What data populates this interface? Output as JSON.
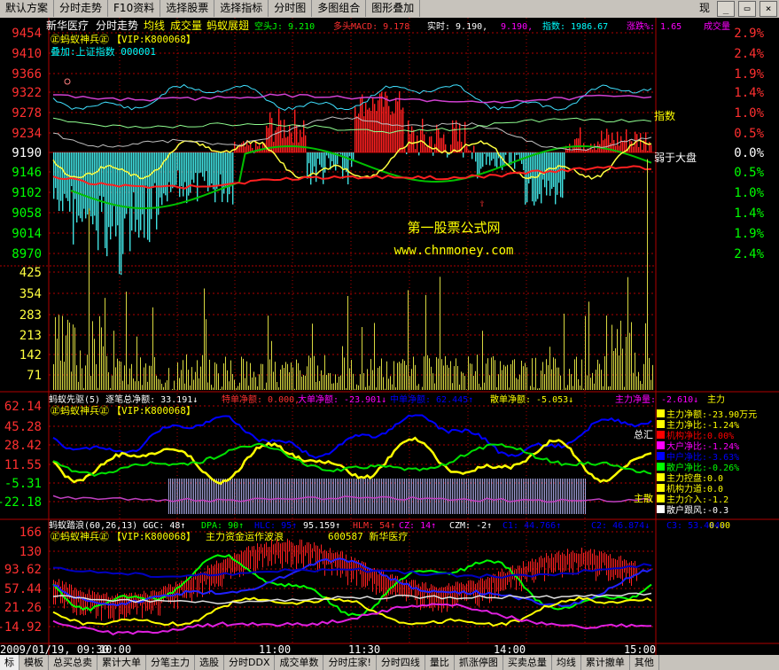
{
  "toolbar": {
    "items": [
      "默认方案",
      "分时走势",
      "F10资料",
      "选择股票",
      "选择指标",
      "分时图",
      "多图组合",
      "图形叠加"
    ],
    "right_label": "现"
  },
  "header": {
    "stock_name": "新华医疗",
    "mode": "分时走势",
    "items": [
      "均线",
      "成交量",
      "蚂蚁展翅"
    ],
    "air_j": "空头J: 9.210",
    "multi_macd": "多头MACD: 9.178",
    "realtime": "实时: 9.190,",
    "realtime_tail": "9.190,",
    "index": "指数: 1986.67",
    "change_pct": "涨跌%: 1.65",
    "turnover": "成交量"
  },
  "logo_text": "㊣蚂蚁神兵㊣",
  "vip_text": "【VIP:K800068】",
  "overlay_text": "叠加:上证指数 000001",
  "price_axis": [
    "9454",
    "9410",
    "9366",
    "9322",
    "9278",
    "9234",
    "9190",
    "9146",
    "9102",
    "9058",
    "9014",
    "8970"
  ],
  "pct_axis": [
    "2.9%",
    "2.4%",
    "1.9%",
    "1.4%",
    "1.0%",
    "0.5%",
    "0.0%",
    "0.5%",
    "1.0%",
    "1.4%",
    "1.9%",
    "2.4%"
  ],
  "volume_axis": [
    "425",
    "354",
    "283",
    "213",
    "142",
    "71"
  ],
  "watermark": {
    "cn": "第一股票公式网",
    "url": "www.chnmoney.com"
  },
  "labels": {
    "index_label": "指数",
    "weak_label": "弱于大盘"
  },
  "panel2": {
    "title": "蚂蚁先驱(5) 逐笔总净额: 33.191↓",
    "special": "特单净额: 0.000,",
    "big": "大单净额: -23.901↓",
    "mid": "中单净额: 62.445↑",
    "scatter": "散单净额: -5.053↓",
    "main": "主力净量: -2.610↓",
    "main_tail": "主力",
    "axis": [
      "62.14",
      "45.28",
      "28.42",
      "11.55",
      "-5.31",
      "-22.18"
    ],
    "side_total": "总汇",
    "side_net": "主散",
    "legend": [
      {
        "text": "主力净额:-23.90万元",
        "color": "#ffff00"
      },
      {
        "text": "主力净比:-1.24%",
        "color": "#ffff00"
      },
      {
        "text": "机构净比:0.00%",
        "color": "#ff0000"
      },
      {
        "text": "大户净比:-1.24%",
        "color": "#ff00ff"
      },
      {
        "text": "中户净比:-3.63%",
        "color": "#0000ff"
      },
      {
        "text": "散户净比:-0.26%",
        "color": "#00ff00"
      },
      {
        "text": "主力控盘:0.0",
        "color": "#ffff00"
      },
      {
        "text": "机构力道:0.0",
        "color": "#ffff00"
      },
      {
        "text": "主力介入:-1.2",
        "color": "#ffff00"
      },
      {
        "text": "散户跟风:-0.3",
        "color": "#ffffff"
      }
    ]
  },
  "panel3": {
    "title": "蚂蚁踏浪(60,26,13) GGC: 48↑",
    "dpa": "DPA: 90↑",
    "hlc": "HLC: 95↑",
    "v95": "95.159↑",
    "hlm": "HLM: 54↑",
    "cz": "CZ: 14↑",
    "czm": "CZM: -2↑",
    "c1": "C1: 44.766↑",
    "c2": "C2: 46.874↓",
    "c3": "C3: 53.444↓",
    "last": "0.00",
    "sub": "主力资金运作波浪",
    "code": "600587 新华医疗",
    "axis": [
      "166",
      "130",
      "93.62",
      "57.44",
      "21.26",
      "-14.92"
    ]
  },
  "time_axis": {
    "date": "2009/01/19, 09:30",
    "t1": "10:00",
    "t2": "11:00",
    "t3": "11:30",
    "t4": "14:00",
    "t5": "15:00"
  },
  "bottom_tabs": [
    "标",
    "模板",
    "总买总卖",
    "累计大单",
    "分笔主力",
    "选股",
    "分时DDX",
    "成交单数",
    "分时庄家!",
    "分时四线",
    "量比",
    "抓涨停图",
    "买卖总量",
    "均线",
    "累计撤单",
    "其他"
  ]
}
